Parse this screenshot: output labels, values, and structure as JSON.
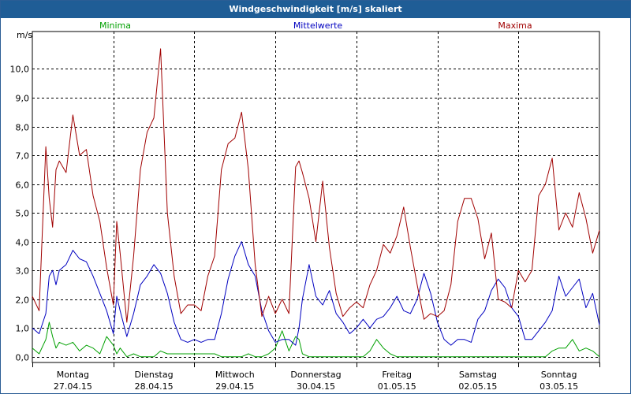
{
  "window": {
    "title": "Windgeschwindigkeit [m/s] skaliert"
  },
  "colors": {
    "minima": "#00a000",
    "mittel": "#0000c0",
    "maxima": "#a00000",
    "grid": "#000000"
  },
  "chart_data": {
    "type": "line",
    "ylabel": "m/s",
    "ylim": [
      -0.2,
      11.3
    ],
    "yticks": [
      "0,0",
      "1,0",
      "2,0",
      "3,0",
      "4,0",
      "5,0",
      "6,0",
      "7,0",
      "8,0",
      "9,0",
      "10,0"
    ],
    "xlim": [
      0,
      168
    ],
    "days": [
      {
        "weekday": "Montag",
        "date": "27.04.15"
      },
      {
        "weekday": "Dienstag",
        "date": "28.04.15"
      },
      {
        "weekday": "Mittwoch",
        "date": "29.04.15"
      },
      {
        "weekday": "Donnerstag",
        "date": "30.04.15"
      },
      {
        "weekday": "Freitag",
        "date": "01.05.15"
      },
      {
        "weekday": "Samstag",
        "date": "02.05.15"
      },
      {
        "weekday": "Sonntag",
        "date": "03.05.15"
      }
    ],
    "series": [
      {
        "name": "Minima",
        "key": "minima",
        "x": [
          0,
          2,
          4,
          5,
          6,
          7,
          8,
          10,
          12,
          14,
          16,
          18,
          20,
          22,
          24,
          25,
          26,
          28,
          30,
          32,
          34,
          36,
          38,
          40,
          42,
          44,
          46,
          48,
          50,
          52,
          54,
          56,
          58,
          60,
          62,
          64,
          66,
          68,
          70,
          72,
          74,
          76,
          78,
          79,
          80,
          82,
          84,
          86,
          88,
          90,
          92,
          94,
          96,
          98,
          100,
          102,
          104,
          106,
          108,
          110,
          112,
          114,
          116,
          118,
          120,
          122,
          124,
          126,
          128,
          130,
          132,
          134,
          136,
          138,
          140,
          142,
          144,
          146,
          148,
          150,
          152,
          154,
          156,
          158,
          160,
          162,
          164,
          166,
          168
        ],
        "values": [
          0.3,
          0.1,
          0.6,
          1.2,
          0.7,
          0.3,
          0.5,
          0.4,
          0.5,
          0.2,
          0.4,
          0.3,
          0.1,
          0.7,
          0.4,
          0.1,
          0.3,
          0.0,
          0.1,
          0.0,
          0.0,
          0.0,
          0.2,
          0.1,
          0.1,
          0.1,
          0.1,
          0.1,
          0.1,
          0.1,
          0.1,
          0.0,
          0.0,
          0.0,
          0.0,
          0.1,
          0.0,
          0.0,
          0.1,
          0.3,
          0.9,
          0.2,
          0.7,
          0.6,
          0.1,
          0.0,
          0.0,
          0.0,
          0.0,
          0.0,
          0.0,
          0.0,
          0.0,
          0.0,
          0.2,
          0.6,
          0.3,
          0.1,
          0.0,
          0.0,
          0.0,
          0.0,
          0.0,
          0.0,
          0.0,
          0.0,
          0.0,
          0.0,
          0.0,
          0.0,
          0.0,
          0.0,
          0.0,
          0.0,
          0.0,
          0.0,
          0.0,
          0.0,
          0.0,
          0.0,
          0.0,
          0.2,
          0.3,
          0.3,
          0.6,
          0.2,
          0.3,
          0.2,
          0.0
        ]
      },
      {
        "name": "Mittelwerte",
        "key": "mittel",
        "x": [
          0,
          2,
          4,
          5,
          6,
          7,
          8,
          10,
          12,
          14,
          16,
          18,
          20,
          22,
          24,
          25,
          26,
          28,
          30,
          32,
          34,
          36,
          38,
          40,
          42,
          44,
          46,
          48,
          50,
          52,
          54,
          56,
          58,
          60,
          62,
          64,
          66,
          68,
          70,
          72,
          74,
          76,
          78,
          79,
          80,
          82,
          84,
          86,
          88,
          90,
          92,
          94,
          96,
          98,
          100,
          102,
          104,
          106,
          108,
          110,
          112,
          114,
          116,
          118,
          120,
          122,
          124,
          126,
          128,
          130,
          132,
          134,
          136,
          138,
          140,
          142,
          144,
          146,
          148,
          150,
          152,
          154,
          156,
          158,
          160,
          162,
          164,
          166,
          168
        ],
        "values": [
          1.0,
          0.8,
          1.5,
          2.8,
          3.0,
          2.5,
          3.0,
          3.2,
          3.7,
          3.4,
          3.3,
          2.8,
          2.2,
          1.6,
          0.8,
          2.1,
          1.6,
          0.7,
          1.5,
          2.5,
          2.8,
          3.2,
          2.9,
          2.2,
          1.2,
          0.6,
          0.5,
          0.6,
          0.5,
          0.6,
          0.6,
          1.5,
          2.7,
          3.5,
          4.0,
          3.2,
          2.8,
          1.6,
          0.9,
          0.5,
          0.6,
          0.6,
          0.4,
          1.0,
          2.0,
          3.2,
          2.1,
          1.8,
          2.3,
          1.5,
          1.2,
          0.8,
          1.0,
          1.3,
          1.0,
          1.3,
          1.4,
          1.7,
          2.1,
          1.6,
          1.5,
          2.0,
          2.9,
          2.2,
          1.2,
          0.6,
          0.4,
          0.6,
          0.6,
          0.5,
          1.3,
          1.6,
          2.3,
          2.7,
          2.4,
          1.7,
          1.4,
          0.6,
          0.6,
          0.9,
          1.2,
          1.6,
          2.8,
          2.1,
          2.4,
          2.7,
          1.7,
          2.2,
          1.1
        ]
      },
      {
        "name": "Maxima",
        "key": "maxima",
        "x": [
          0,
          2,
          4,
          5,
          6,
          7,
          8,
          10,
          12,
          14,
          16,
          18,
          20,
          22,
          24,
          25,
          26,
          28,
          30,
          32,
          34,
          36,
          38,
          40,
          42,
          44,
          46,
          48,
          50,
          52,
          54,
          56,
          58,
          60,
          62,
          64,
          66,
          68,
          70,
          72,
          74,
          76,
          78,
          79,
          80,
          82,
          84,
          86,
          88,
          90,
          92,
          94,
          96,
          98,
          100,
          102,
          104,
          106,
          108,
          110,
          112,
          114,
          116,
          118,
          120,
          122,
          124,
          126,
          128,
          130,
          132,
          134,
          136,
          138,
          140,
          142,
          144,
          146,
          148,
          150,
          152,
          154,
          156,
          158,
          160,
          162,
          164,
          166,
          168
        ],
        "values": [
          2.1,
          1.6,
          7.3,
          5.5,
          4.5,
          6.5,
          6.8,
          6.4,
          8.4,
          7.0,
          7.2,
          5.6,
          4.7,
          3.1,
          1.8,
          4.7,
          3.6,
          1.2,
          3.5,
          6.5,
          7.8,
          8.3,
          10.7,
          5.0,
          2.8,
          1.5,
          1.8,
          1.8,
          1.6,
          2.8,
          3.5,
          6.5,
          7.4,
          7.6,
          8.5,
          6.5,
          3.2,
          1.4,
          2.1,
          1.5,
          2.0,
          1.5,
          6.6,
          6.8,
          6.4,
          5.5,
          4.0,
          6.1,
          3.8,
          2.2,
          1.4,
          1.7,
          1.9,
          1.7,
          2.5,
          3.0,
          3.9,
          3.6,
          4.2,
          5.2,
          3.8,
          2.5,
          1.3,
          1.5,
          1.4,
          1.6,
          2.5,
          4.7,
          5.5,
          5.5,
          4.8,
          3.4,
          4.3,
          2.0,
          1.9,
          1.7,
          3.0,
          2.6,
          3.0,
          5.6,
          6.0,
          6.9,
          4.4,
          5.0,
          4.5,
          5.7,
          4.8,
          3.6,
          4.4
        ]
      }
    ]
  }
}
